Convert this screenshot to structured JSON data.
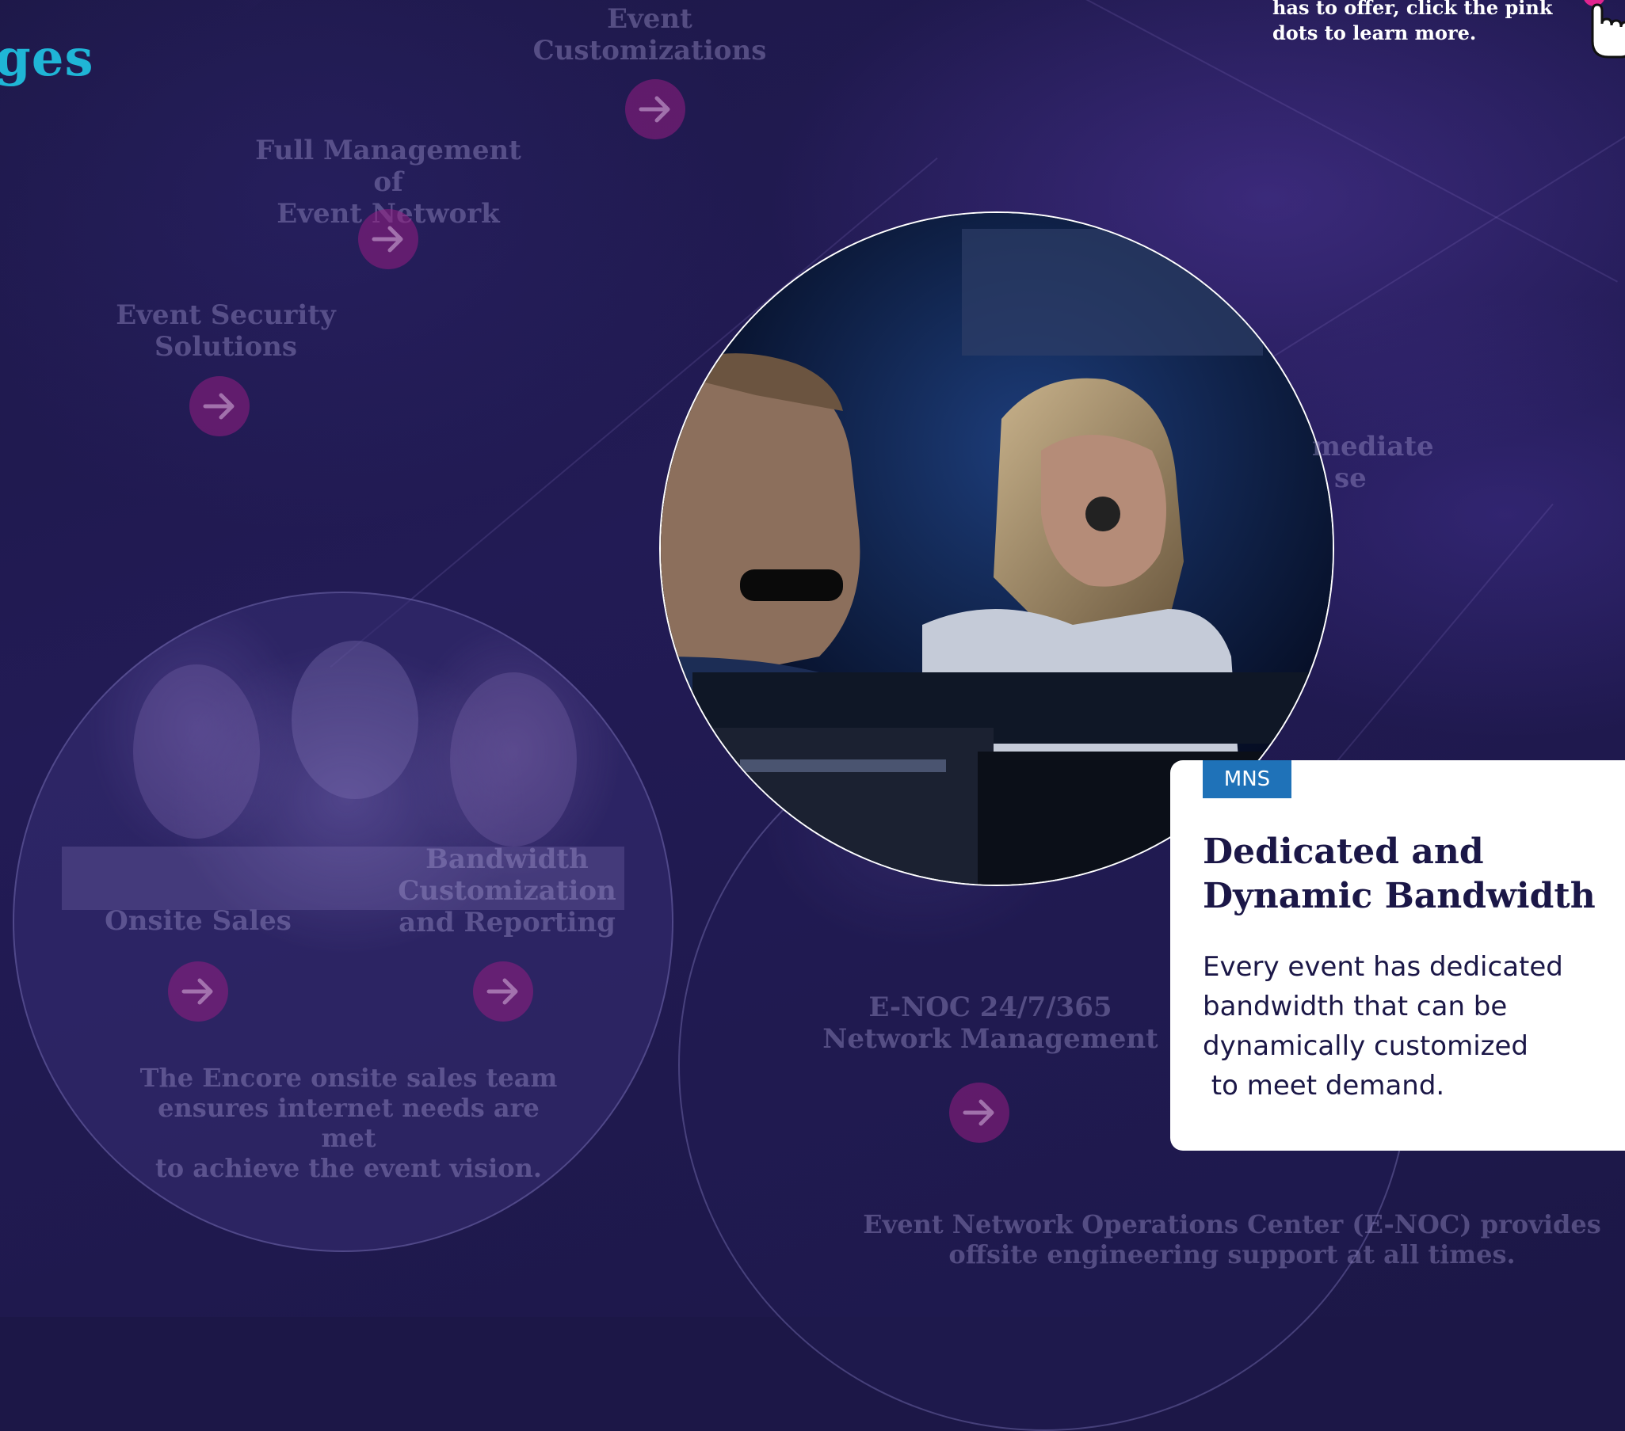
{
  "page": {
    "title_fragment": "ges"
  },
  "hint": {
    "lines": [
      "has to offer, click the pink",
      "dots to learn more."
    ],
    "icon": "hand-pointer-icon"
  },
  "features": [
    {
      "id": "event-customizations",
      "lines": [
        "Event",
        "Customizations"
      ]
    },
    {
      "id": "full-management",
      "lines": [
        "Full Management of",
        "Event Network"
      ]
    },
    {
      "id": "event-security",
      "lines": [
        "Event Security",
        "Solutions"
      ]
    },
    {
      "id": "onsite-sales",
      "lines": [
        "Onsite Sales"
      ]
    },
    {
      "id": "bandwidth-customization",
      "lines": [
        "Bandwidth",
        "Customization",
        "and Reporting"
      ]
    },
    {
      "id": "enoc",
      "lines": [
        "E-NOC 24/7/365",
        "Network Management"
      ]
    },
    {
      "id": "immediate-response",
      "lines": [
        "mediate",
        "se"
      ]
    }
  ],
  "descriptions": {
    "onsite_sales": [
      "The Encore onsite sales team",
      "ensures internet needs are met",
      "to achieve the event vision."
    ],
    "enoc": [
      "Event Network Operations Center (E-NOC) provides",
      "offsite engineering support at all times."
    ]
  },
  "card": {
    "tag": "MNS",
    "title_lines": [
      "Dedicated and",
      "Dynamic Bandwidth"
    ],
    "body_lines": [
      "Every event has dedicated",
      "bandwidth that can be",
      "dynamically customized",
      " to meet demand."
    ]
  },
  "colors": {
    "background": "#1c1747",
    "accent_teal": "#1fb5d6",
    "pink_dot": "#961e82",
    "tag_blue": "#1f72b8",
    "card_text": "#1b1747"
  },
  "icons": {
    "arrow": "arrow-right-icon"
  }
}
